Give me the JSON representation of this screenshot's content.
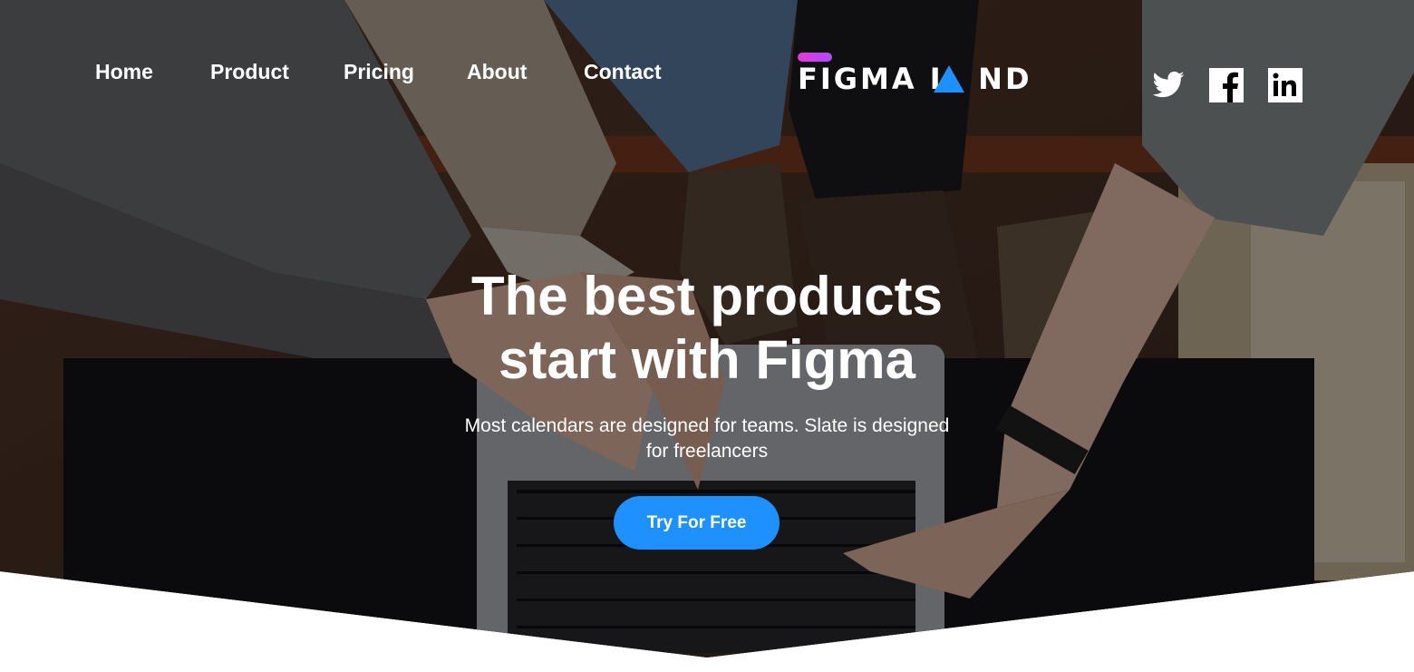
{
  "nav": {
    "items": [
      {
        "label": "Home"
      },
      {
        "label": "Product"
      },
      {
        "label": "Pricing"
      },
      {
        "label": "About"
      },
      {
        "label": "Contact"
      }
    ]
  },
  "logo": {
    "text_left": "FIGMA L",
    "text_right": "ND",
    "accent_color": "#1e90ff"
  },
  "social": [
    "twitter-icon",
    "facebook-icon",
    "linkedin-icon"
  ],
  "hero": {
    "headline_line1": "The best products",
    "headline_line2": "start with Figma",
    "subtitle_line1": "Most calendars are designed for teams. Slate is designed",
    "subtitle_line2": "for freelancers",
    "cta_label": "Try For Free",
    "cta_color": "#1e90ff"
  }
}
